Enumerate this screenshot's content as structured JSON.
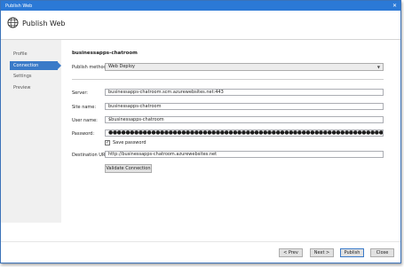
{
  "window": {
    "title": "Publish Web",
    "close_glyph": "✕"
  },
  "header": {
    "title": "Publish Web",
    "icon": "globe-icon"
  },
  "sidebar": {
    "items": [
      {
        "label": "Profile",
        "active": false
      },
      {
        "label": "Connection",
        "active": true
      },
      {
        "label": "Settings",
        "active": false
      },
      {
        "label": "Preview",
        "active": false
      }
    ]
  },
  "main": {
    "section_title": "businessapps-chatroom",
    "publish_method": {
      "label": "Publish method:",
      "value": "Web Deploy"
    },
    "server": {
      "label": "Server:",
      "value": "businessapps-chatroom.scm.azurewebsites.net:443"
    },
    "site_name": {
      "label": "Site name:",
      "value": "businessapps-chatroom"
    },
    "user_name": {
      "label": "User name:",
      "value": "$businessapps-chatroom"
    },
    "password": {
      "label": "Password:",
      "value": "●●●●●●●●●●●●●●●●●●●●●●●●●●●●●●●●●●●●●●●●●●●●●●●●●●●●●●●●●●●●●●●●●●●●●●●●●●●●●●●●●●●●●"
    },
    "save_password": {
      "label": "Save password",
      "checked": true,
      "mark": "✓"
    },
    "destination_url": {
      "label": "Destination URL:",
      "value": "http://businessapps-chatroom.azurewebsites.net"
    },
    "validate_button": "Validate Connection"
  },
  "footer": {
    "prev": "< Prev",
    "next": "Next >",
    "publish": "Publish",
    "close": "Close"
  },
  "colors": {
    "accent": "#3a7ac8",
    "titlebar": "#2b79d6"
  }
}
